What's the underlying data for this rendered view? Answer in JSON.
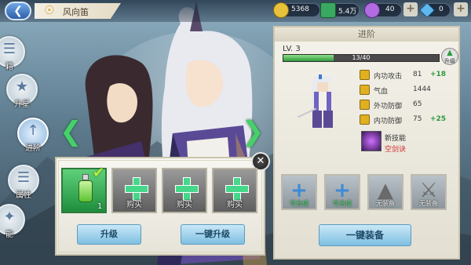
{
  "header": {
    "title": "风向笛",
    "resources": [
      {
        "name": "gold",
        "value": "5368",
        "color": "#e8c23a"
      },
      {
        "name": "jade",
        "value": "5.4万",
        "color": "#39a860"
      },
      {
        "name": "orb",
        "value": "40",
        "color": "#b06ce0"
      },
      {
        "name": "diamond",
        "value": "0",
        "color": "#5fb8f0"
      }
    ]
  },
  "nav": [
    {
      "label": "籍",
      "icon": "book-icon"
    },
    {
      "label": "升星",
      "icon": "star-icon"
    },
    {
      "label": "进阶",
      "icon": "advance-arrow-icon",
      "active": true
    },
    {
      "label": "属性",
      "icon": "list-icon"
    },
    {
      "label": "能",
      "icon": "skill-icon"
    }
  ],
  "items": {
    "slots": [
      {
        "label": "",
        "count": "1",
        "type": "potion",
        "selected": true
      },
      {
        "label": "购买",
        "type": "plus"
      },
      {
        "label": "购买",
        "type": "plus"
      },
      {
        "label": "购买",
        "type": "plus"
      }
    ],
    "upgrade_label": "升级",
    "upgrade_all_label": "一键升级"
  },
  "panel": {
    "title": "进阶",
    "level": "LV. 3",
    "exp_text": "13/40",
    "exp_ratio": 0.325,
    "upgrade_label": "升级",
    "stats": [
      {
        "name": "内功攻击",
        "value": "81",
        "bonus": "+18"
      },
      {
        "name": "气血",
        "value": "1444",
        "bonus": ""
      },
      {
        "name": "外功防御",
        "value": "65",
        "bonus": ""
      },
      {
        "name": "内功防御",
        "value": "75",
        "bonus": "+25"
      }
    ],
    "skill": {
      "label": "新技能",
      "name": "空剑诀"
    },
    "equipment": [
      {
        "label": "可合成",
        "state": "craftable"
      },
      {
        "label": "可合成",
        "state": "craftable"
      },
      {
        "label": "无装备",
        "state": "empty"
      },
      {
        "label": "无装备",
        "state": "empty"
      }
    ],
    "equip_all_label": "一键装备"
  }
}
